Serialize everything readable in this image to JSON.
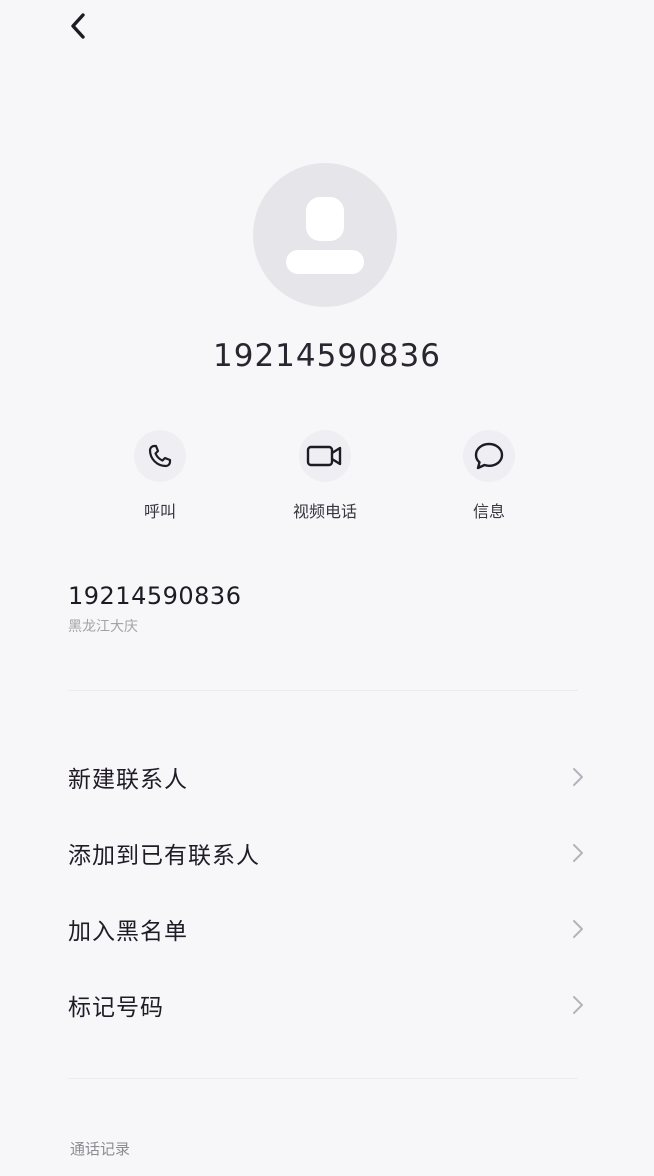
{
  "header": {
    "back_icon": "chevron-left-icon"
  },
  "contact": {
    "avatar_icon": "person-silhouette-icon",
    "number": "19214590836"
  },
  "actions": [
    {
      "label": "呼叫",
      "icon": "phone-icon"
    },
    {
      "label": "视频电话",
      "icon": "video-camera-icon"
    },
    {
      "label": "信息",
      "icon": "message-bubble-icon"
    }
  ],
  "info": {
    "number": "19214590836",
    "location": "黑龙江大庆"
  },
  "menu": [
    {
      "label": "新建联系人"
    },
    {
      "label": "添加到已有联系人"
    },
    {
      "label": "加入黑名单"
    },
    {
      "label": "标记号码"
    }
  ],
  "footer": {
    "section_label": "通话记录"
  },
  "colors": {
    "background": "#f7f7fa",
    "avatar_bg": "#e6e6ea",
    "text_primary": "#1e1b24",
    "text_secondary": "#a3a2a8",
    "chevron": "#b5b4ba"
  }
}
